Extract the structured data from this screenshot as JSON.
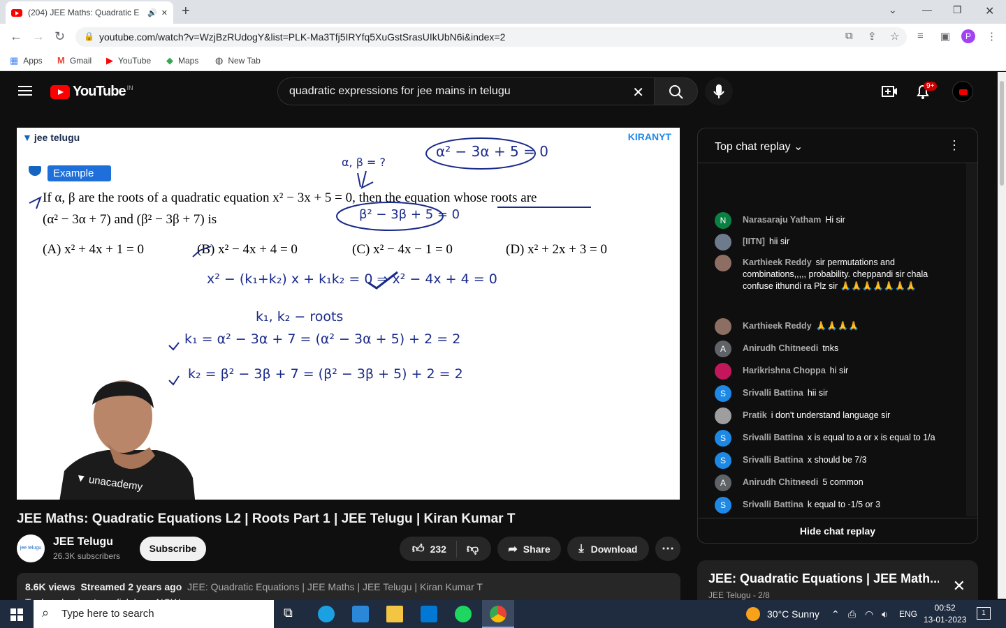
{
  "browser": {
    "tab_title": "(204) JEE Maths: Quadratic E",
    "url": "youtube.com/watch?v=WzjBzRUdogY&list=PLK-Ma3Tfj5IRYfq5XuGstSrasUIkUbN6i&index=2",
    "profile_letter": "P",
    "bookmarks": [
      "Apps",
      "Gmail",
      "YouTube",
      "Maps",
      "New Tab"
    ]
  },
  "youtube": {
    "country_code": "IN",
    "logo_text": "YouTube",
    "search_value": "quadratic expressions for jee mains in telugu",
    "notifications_badge": "9+"
  },
  "video_frame": {
    "brand": "jee telugu",
    "watermark": "KIRANYT",
    "example_label": "Example",
    "question_line1": "If α, β are the roots of a quadratic equation x² − 3x + 5 = 0, then the equation whose roots are",
    "question_line2": "(α² − 3α + 7) and (β² − 3β + 7) is",
    "option_a": "(A) x² + 4x + 1 = 0",
    "option_b": "(B) x² − 4x + 4 = 0",
    "option_c": "(C) x² − 4x − 1 = 0",
    "option_d": "(D) x² + 2x + 3 = 0",
    "teacher_shirt": "unacademy",
    "hw_roots": "α, β = ?",
    "hw_eq_top": "α² − 3α + 5 = 0",
    "hw_eq_beta": "β² − 3β + 5 = 0",
    "hw_line1": "x² − (k₁+k₂) x + k₁k₂ = 0  ⇒  x² − 4x + 4 = 0",
    "hw_line2": "k₁, k₂ − roots",
    "hw_line3": "k₁ = α² − 3α + 7 = (α² − 3α + 5) + 2 = 2",
    "hw_line4": "k₂ = β² − 3β + 7 = (β² − 3β + 5) + 2 = 2"
  },
  "video_info": {
    "title": "JEE Maths: Quadratic Equations L2 | Roots Part 1 | JEE Telugu | Kiran Kumar T",
    "channel": "JEE Telugu",
    "channel_avatar_text": "jee telugu",
    "subscribers": "26.3K subscribers",
    "subscribe_label": "Subscribe",
    "likes": "232",
    "share_label": "Share",
    "download_label": "Download",
    "views": "8.6K views",
    "streamed": "Streamed 2 years ago",
    "hashtags": "JEE: Quadratic Equations | JEE Maths | JEE Telugu | Kiran Kumar T",
    "desc_line2": "To download notes, click here NOW:"
  },
  "chat": {
    "header": "Top chat replay",
    "footer": "Hide chat replay",
    "messages": [
      {
        "initial": "N",
        "color": "#0b8043",
        "author": "Narasaraju Yatham",
        "text": "Hi sir"
      },
      {
        "initial": "",
        "color": "#6d7b8d",
        "author": "[IITN]",
        "text": "hii sir"
      },
      {
        "initial": "",
        "color": "#8d6e63",
        "author": "Karthieek Reddy",
        "text": "sir permutations and combinations,,,,, probability. cheppandi sir chala confuse ithundi ra Plz sir 🙏🙏🙏🙏🙏🙏🙏"
      },
      {
        "initial": "",
        "color": "#8d6e63",
        "author": "Karthieek Reddy",
        "text": "🙏🙏🙏🙏"
      },
      {
        "initial": "A",
        "color": "#5f6368",
        "author": "Anirudh Chitneedi",
        "text": "tnks"
      },
      {
        "initial": "",
        "color": "#c2185b",
        "author": "Harikrishna Choppa",
        "text": "hi sir"
      },
      {
        "initial": "S",
        "color": "#1e88e5",
        "author": "Srivalli Battina",
        "text": "hii sir"
      },
      {
        "initial": "",
        "color": "#9e9e9e",
        "author": "Pratik",
        "text": "i don't understand language sir"
      },
      {
        "initial": "S",
        "color": "#1e88e5",
        "author": "Srivalli Battina",
        "text": "x is equal to a or x is equal to 1/a"
      },
      {
        "initial": "S",
        "color": "#1e88e5",
        "author": "Srivalli Battina",
        "text": "x should be 7/3"
      },
      {
        "initial": "A",
        "color": "#5f6368",
        "author": "Anirudh Chitneedi",
        "text": "5 common"
      },
      {
        "initial": "S",
        "color": "#1e88e5",
        "author": "Srivalli Battina",
        "text": "k equal to -1/5 or 3"
      }
    ]
  },
  "playlist": {
    "title": "JEE: Quadratic Equations | JEE Math...",
    "subtitle": "JEE Telugu - 2/8"
  },
  "taskbar": {
    "search_placeholder": "Type here to search",
    "weather": "30°C  Sunny",
    "lang": "ENG",
    "time": "00:52",
    "date": "13-01-2023",
    "notif_count": "1"
  }
}
